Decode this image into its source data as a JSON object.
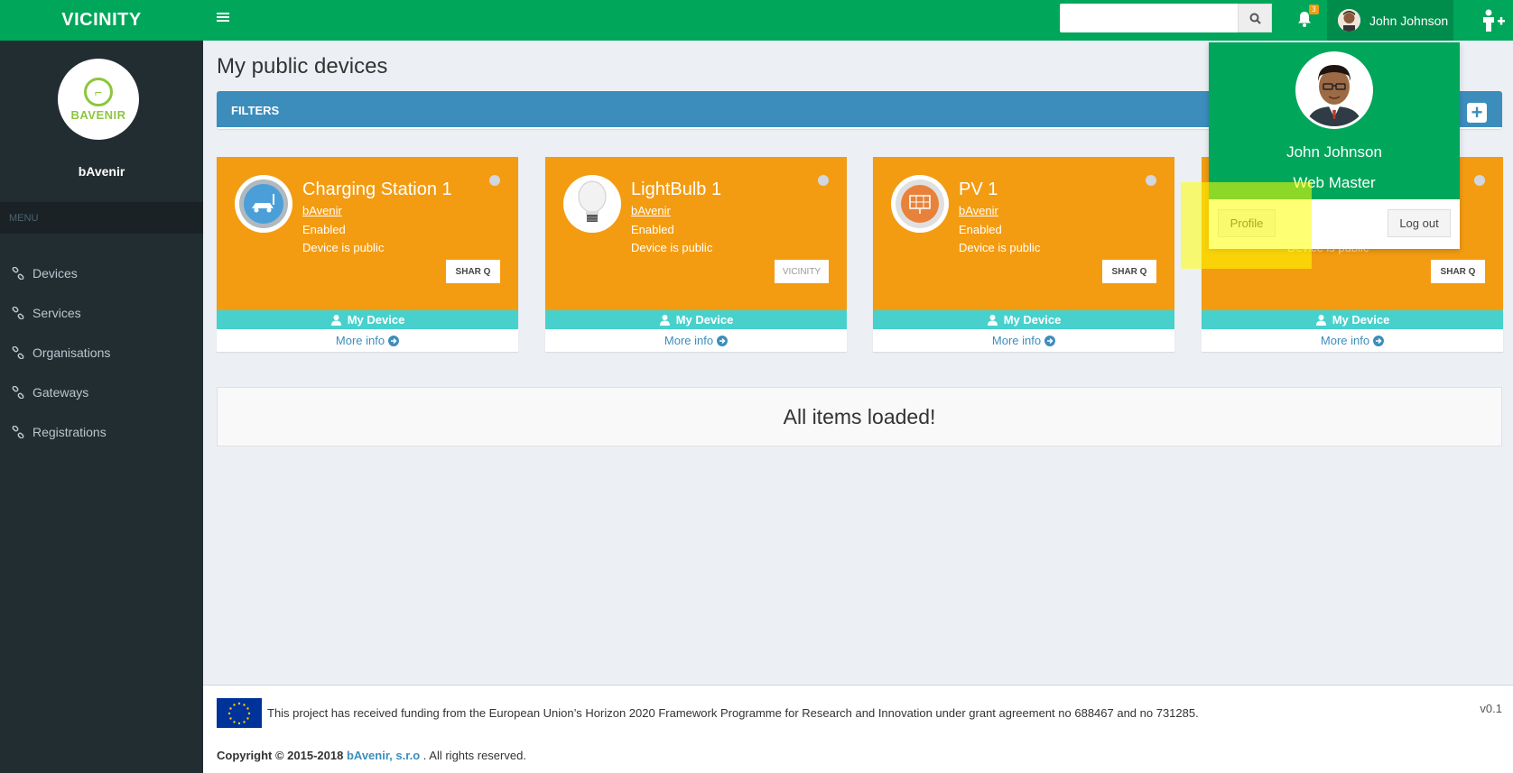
{
  "header": {
    "brand": "VICINITY",
    "notification_count": "3",
    "user_name": "John Johnson"
  },
  "sidebar": {
    "org_logo_text": "BAVENIR",
    "org_name": "bAvenir",
    "menu_header": "MENU",
    "items": [
      {
        "label": "Devices"
      },
      {
        "label": "Services"
      },
      {
        "label": "Organisations"
      },
      {
        "label": "Gateways"
      },
      {
        "label": "Registrations"
      }
    ]
  },
  "main": {
    "page_title": "My public devices",
    "filters_label": "FILTERS",
    "loaded_message": "All items loaded!",
    "cards": [
      {
        "title": "Charging Station 1",
        "owner": "bAvenir",
        "status": "Enabled",
        "visibility": "Device is public",
        "brand": "SHAR Q",
        "footer": "My Device",
        "more": "More info",
        "icon": "charging-station-icon"
      },
      {
        "title": "LightBulb 1",
        "owner": "bAvenir",
        "status": "Enabled",
        "visibility": "Device is public",
        "brand": "VICINITY",
        "footer": "My Device",
        "more": "More info",
        "icon": "lightbulb-icon"
      },
      {
        "title": "PV 1",
        "owner": "bAvenir",
        "status": "Enabled",
        "visibility": "Device is public",
        "brand": "SHAR Q",
        "footer": "My Device",
        "more": "More info",
        "icon": "solar-panel-icon"
      },
      {
        "title": "",
        "owner": "",
        "status": "",
        "visibility": "Device is public",
        "brand": "SHAR Q",
        "footer": "My Device",
        "more": "More info",
        "icon": ""
      }
    ]
  },
  "user_dropdown": {
    "name": "John Johnson",
    "role": "Web Master",
    "profile_label": "Profile",
    "logout_label": "Log out"
  },
  "footer": {
    "funding_text": "This project has received funding from the European Union’s Horizon 2020 Framework Programme for Research and Innovation under grant agreement no 688467 and no 731285.",
    "version": "v0.1",
    "copyright_prefix": "Copyright © 2015-2018",
    "company": "bAvenir, s.r.o",
    "copyright_suffix": ". All rights reserved."
  },
  "colors": {
    "header_green": "#00a65a",
    "sidebar": "#222d32",
    "card_orange": "#f39c12",
    "filters_blue": "#3c8dbc",
    "device_bar": "#48d1cc"
  }
}
